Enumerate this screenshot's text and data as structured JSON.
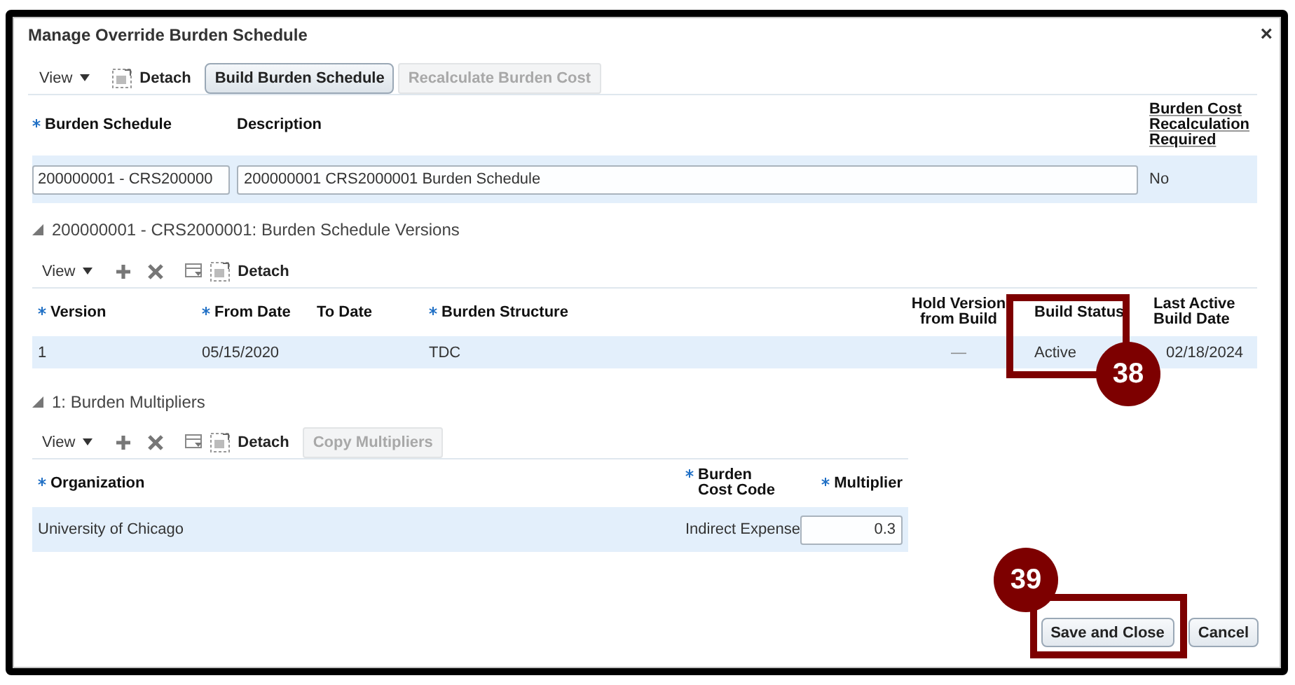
{
  "dialog": {
    "title": "Manage Override Burden Schedule",
    "close": "×"
  },
  "toolbar": {
    "view": "View",
    "detach": "Detach",
    "buttons": [
      {
        "label": "Build Burden Schedule",
        "disabled": false
      },
      {
        "label": "Recalculate Burden Cost",
        "disabled": true
      }
    ]
  },
  "schedule_table": {
    "columns": [
      {
        "label": "Burden Schedule",
        "required": true,
        "sortable": false
      },
      {
        "label": "Description",
        "required": false,
        "sortable": false
      },
      {
        "label": "Burden Cost Recalculation Required",
        "required": false,
        "sortable": true
      }
    ],
    "rows": [
      {
        "selected": true,
        "cells": [
          {
            "kind": "input",
            "value": "200000001 - CRS200000"
          },
          {
            "kind": "input",
            "value": "200000001 CRS2000001 Burden Schedule"
          },
          {
            "kind": "text",
            "value": "No"
          }
        ]
      }
    ]
  },
  "versions": {
    "title": "200000001 - CRS2000001: Burden Schedule Versions",
    "expanded": true,
    "toolbar": {
      "view": "View",
      "detach": "Detach"
    },
    "columns": [
      {
        "label": "Version",
        "required": true
      },
      {
        "label": "From Date",
        "required": true
      },
      {
        "label": "To Date",
        "required": false
      },
      {
        "label": "Burden Structure",
        "required": true
      },
      {
        "label": "Hold Version from Build",
        "required": false
      },
      {
        "label": "Build Status",
        "required": false
      },
      {
        "label": "Last Active Build Date",
        "required": false
      }
    ],
    "rows": [
      {
        "selected": true,
        "cells": [
          {
            "kind": "text",
            "value": "1"
          },
          {
            "kind": "text",
            "value": "05/15/2020"
          },
          {
            "kind": "blank"
          },
          {
            "kind": "text",
            "value": "TDC"
          },
          {
            "kind": "text",
            "value": "—"
          },
          {
            "kind": "text",
            "value": "Active"
          },
          {
            "kind": "text",
            "value": "02/18/2024"
          }
        ]
      }
    ]
  },
  "multipliers": {
    "title": "1: Burden Multipliers",
    "expanded": true,
    "toolbar": {
      "view": "View",
      "detach": "Detach",
      "buttons": [
        {
          "label": "Copy Multipliers",
          "disabled": true
        }
      ]
    },
    "columns": [
      {
        "label": "Organization",
        "required": true
      },
      {
        "label": "Burden Cost Code",
        "required": true
      },
      {
        "label": "Multiplier",
        "required": true
      }
    ],
    "rows": [
      {
        "selected": true,
        "cells": [
          {
            "kind": "text",
            "value": "University of Chicago"
          },
          {
            "kind": "text",
            "value": "Indirect Expense"
          },
          {
            "kind": "input",
            "value": "0.3"
          }
        ]
      }
    ]
  },
  "footer_buttons": [
    {
      "label": "Save and Close"
    },
    {
      "label": "Cancel"
    }
  ],
  "callouts": [
    {
      "label": "38"
    },
    {
      "label": "39"
    }
  ]
}
